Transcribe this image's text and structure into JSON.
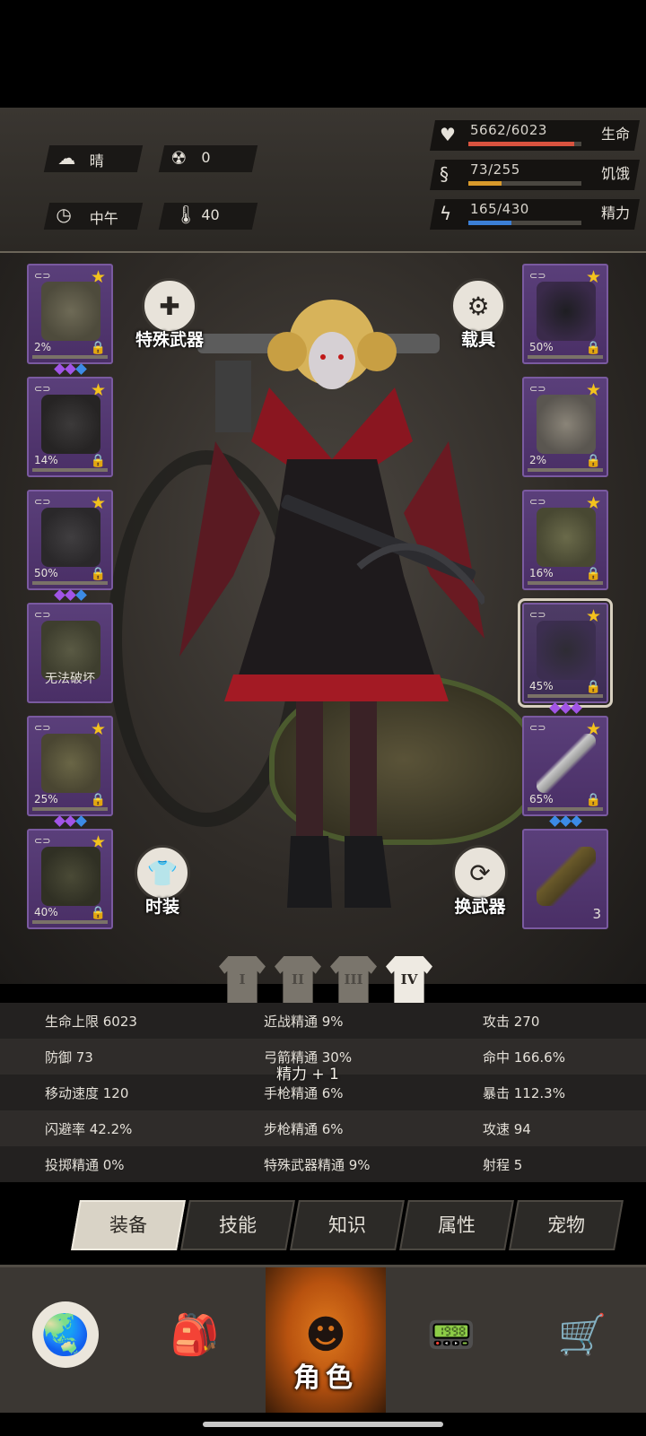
{
  "status": {
    "weather": "晴",
    "radiation": "0",
    "time_of_day": "中午",
    "temperature": "40",
    "body_plus": "+",
    "body_minus": "−"
  },
  "vitals": [
    {
      "value": "5662/6023",
      "label": "生命",
      "icon": "heart-icon",
      "level": 0.94,
      "color": "#d9533f"
    },
    {
      "value": "73/255",
      "label": "饥饿",
      "icon": "stomach-icon",
      "level": 0.29,
      "color": "#d99a2b"
    },
    {
      "value": "165/430",
      "label": "精力",
      "icon": "energy-head-icon",
      "level": 0.38,
      "color": "#3b7fd6"
    }
  ],
  "actions": {
    "special_weapon": "特殊武器",
    "vehicle": "载具",
    "costume": "时装",
    "swap_weapon": "换武器"
  },
  "left_slots": [
    {
      "pct": "2%"
    },
    {
      "pct": "14%"
    },
    {
      "pct": "50%"
    },
    {
      "caption": "无法破坏"
    },
    {
      "pct": "25%"
    },
    {
      "pct": "40%"
    }
  ],
  "right_slots": [
    {
      "pct": "50%"
    },
    {
      "pct": "2%"
    },
    {
      "pct": "16%"
    },
    {
      "pct": "45%"
    },
    {
      "pct": "65%"
    },
    {
      "count": "3"
    }
  ],
  "outfits": [
    "I",
    "II",
    "III",
    "IV"
  ],
  "stats": [
    [
      "生命上限 6023",
      "近战精通 9%",
      "攻击 270"
    ],
    [
      "防御 73",
      "弓箭精通 30%",
      "命中 166.6%"
    ],
    [
      "移动速度 120",
      "手枪精通 6%",
      "暴击 112.3%"
    ],
    [
      "闪避率 42.2%",
      "步枪精通 6%",
      "攻速 94"
    ],
    [
      "投掷精通 0%",
      "特殊武器精通 9%",
      "射程 5"
    ]
  ],
  "toast": "精力 + 1",
  "sub_tabs": [
    "装备",
    "技能",
    "知识",
    "属性",
    "宠物"
  ],
  "nav": {
    "character_label": "角色"
  }
}
